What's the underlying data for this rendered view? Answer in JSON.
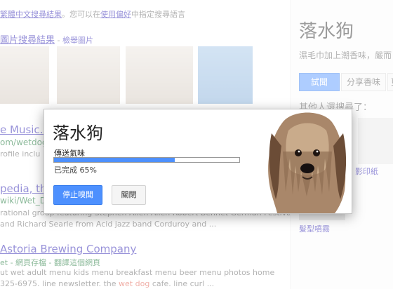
{
  "background": {
    "lang_note": {
      "link": "繁體中文搜尋結果",
      "middle": "。您可以在",
      "settings_link": "使用偏好",
      "end": "中指定搜尋語言"
    },
    "images_header": {
      "title": "圖片搜尋結果",
      "sep": " - ",
      "report": "檢舉圖片"
    },
    "results": [
      {
        "title": "e Music. T",
        "url": "om/wetdog",
        "snippet": "rofile inclu"
      },
      {
        "title": "pedia, the",
        "url": "wiki/Wet_D",
        "snippet": "rational group featuring Stephen Allen Allen Robert Bennet German Festival",
        "snippet2": "and Richard Searle from Acid jazz band Corduroy and ..."
      },
      {
        "title": "Astoria Brewing Company",
        "url": "et - 網頁存檔 - 翻譯這個網頁",
        "snippet": "ut wet adult menu kids menu breakfast menu beer menu photos home",
        "snippet2_a": "325-6975. line newsletter. the ",
        "snippet2_hl": "wet dog",
        "snippet2_b": " cafe. line curl ..."
      }
    ],
    "knowledge_panel": {
      "title": "落水狗",
      "desc": "濕毛巾加上潮香味，嚴而",
      "tabs": [
        "試聞",
        "分享香味",
        "更"
      ],
      "also_searched": "其他人還搜尋了：",
      "items": [
        "影印紙",
        "髮型噴霧"
      ]
    }
  },
  "dialog": {
    "title": "落水狗",
    "status": "傳送氣味",
    "progress_label": "已完成 65%",
    "progress": 0.65,
    "stop_button": "停止嗅聞",
    "close_button": "關閉"
  },
  "colors": {
    "accent": "#4d90fe",
    "link": "#1a0dab",
    "url": "#006621",
    "highlight": "#dd4b39"
  }
}
